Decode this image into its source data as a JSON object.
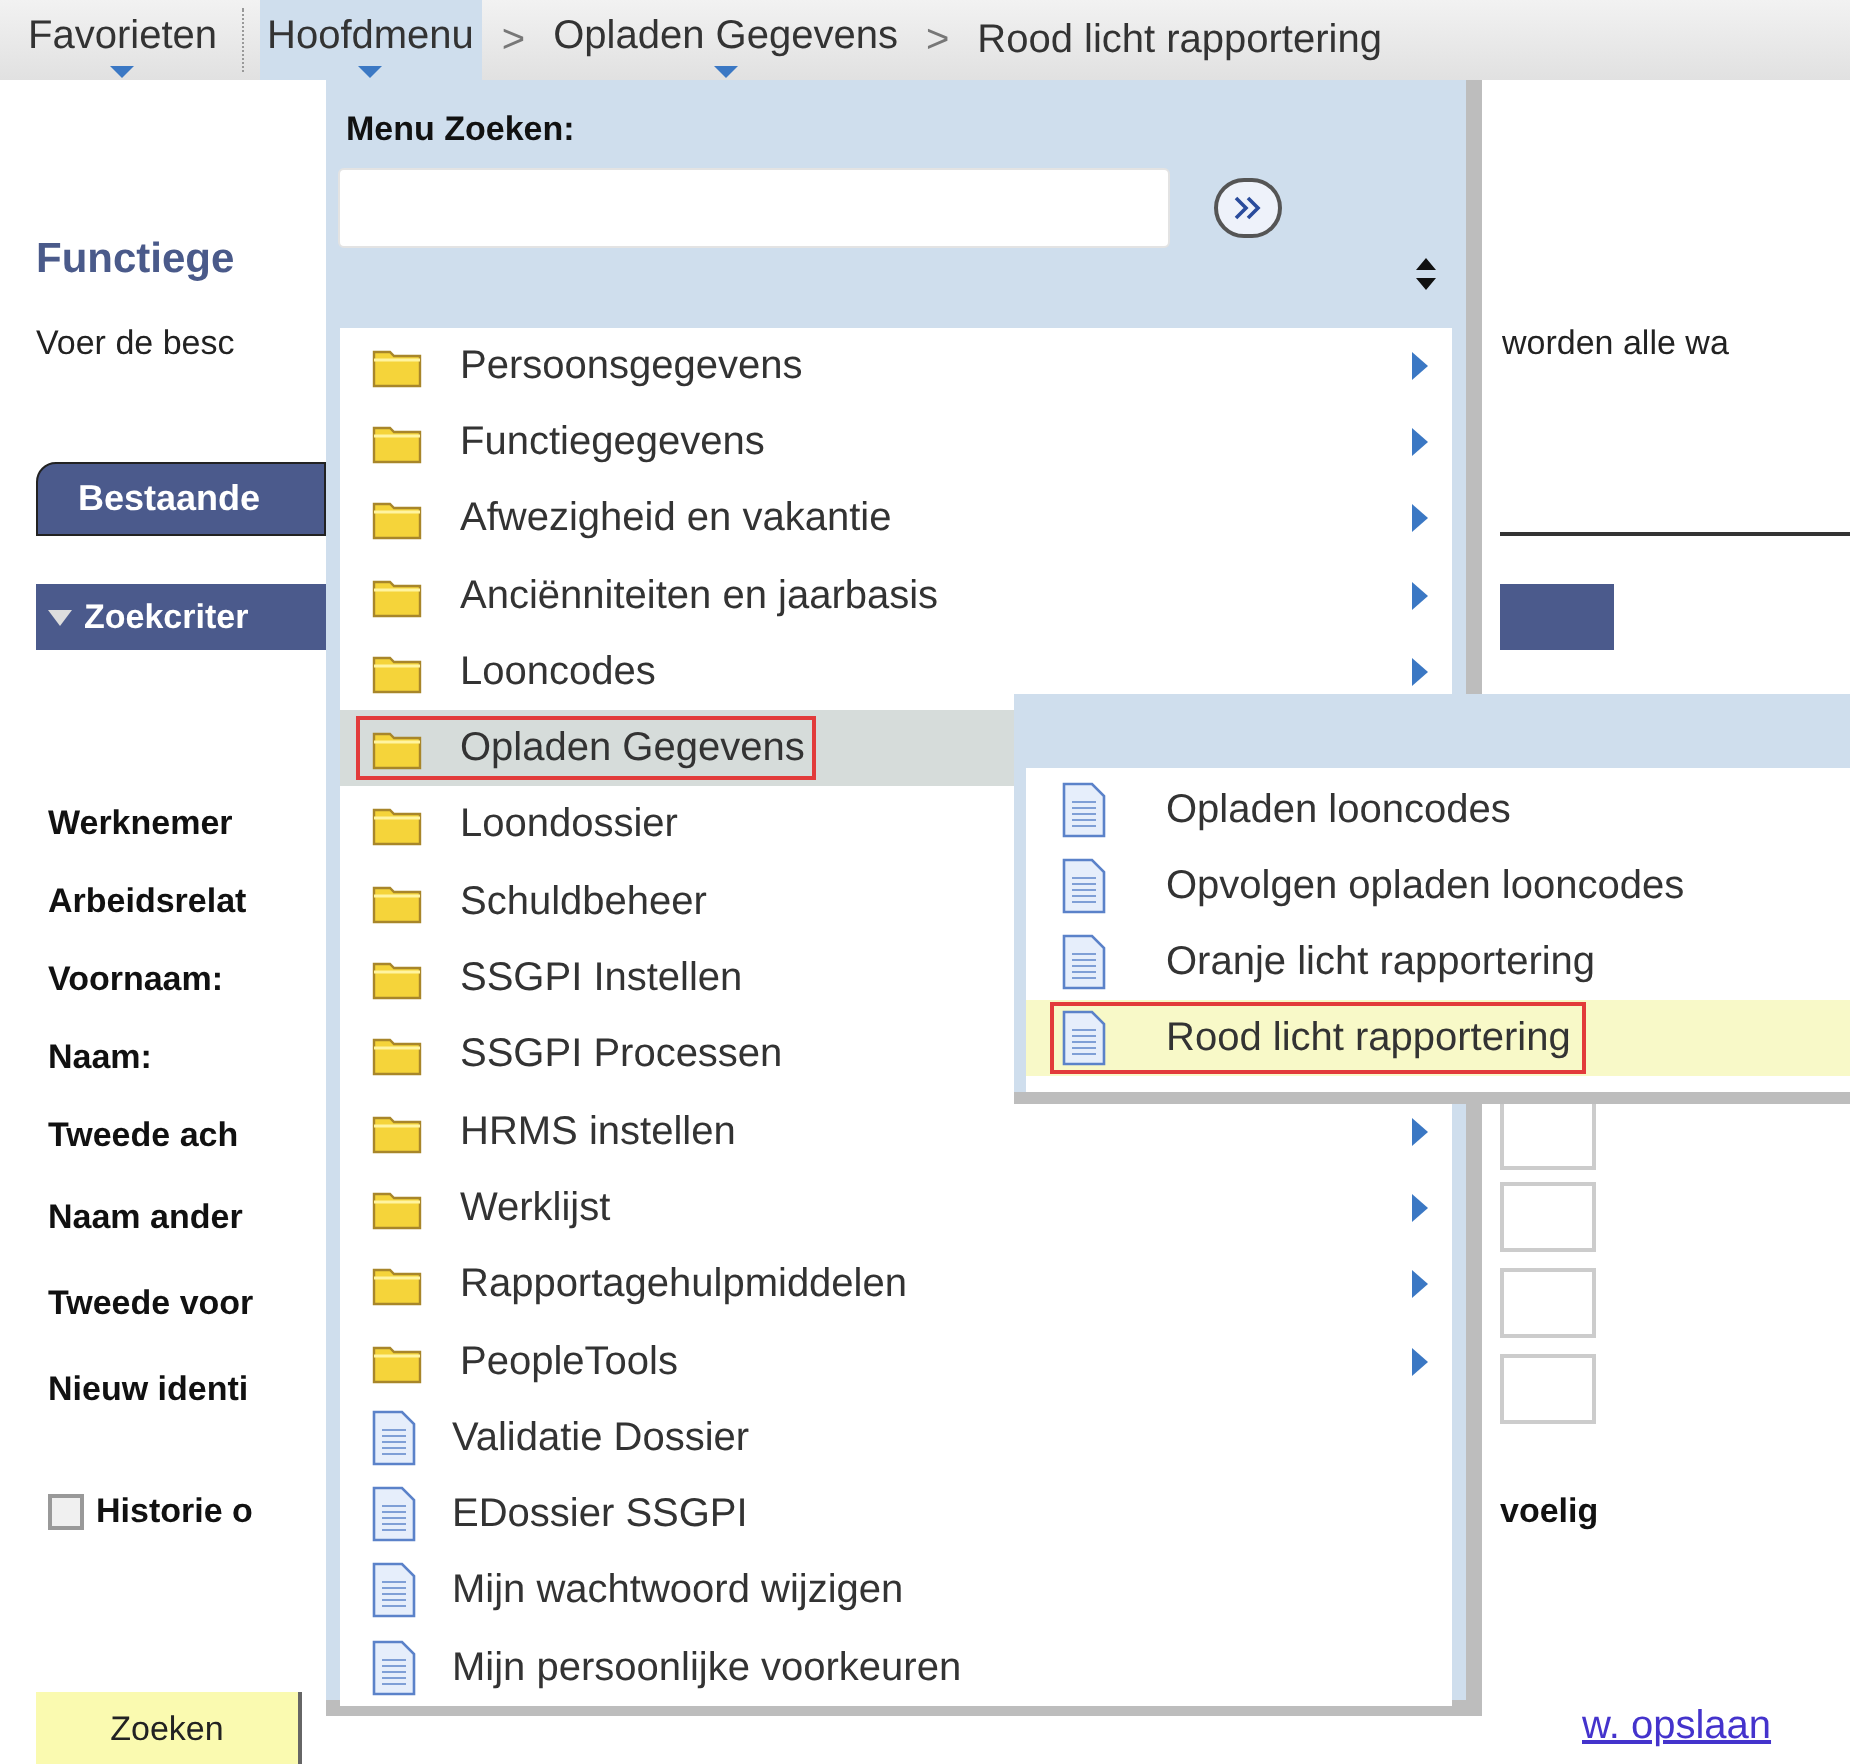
{
  "breadcrumb": [
    {
      "label": "Favorieten",
      "selected": false,
      "dropdown": true
    },
    {
      "label": "Hoofdmenu",
      "selected": true,
      "dropdown": true
    },
    {
      "separator": ">",
      "label": "Opladen Gegevens",
      "selected": false,
      "dropdown": true
    },
    {
      "separator": ">",
      "label": "Rood licht rapportering",
      "selected": false,
      "dropdown": false
    }
  ],
  "page": {
    "title": "Functiege",
    "intro_left": "Voer de besc",
    "intro_right": "worden alle wa",
    "tab": "Bestaande",
    "section": "Zoekcriter",
    "fields": [
      {
        "label": "Werknemer"
      },
      {
        "label": "Arbeidsrelat"
      },
      {
        "label": "Voornaam:"
      },
      {
        "label": "Naam:"
      },
      {
        "label": "Tweede ach",
        "input": true
      },
      {
        "label": "Naam ander",
        "input": true
      },
      {
        "label": "Tweede voor",
        "input": true
      },
      {
        "label": "Nieuw identi",
        "input": true
      }
    ],
    "checkbox": {
      "label_left": "Historie o",
      "label_right": "voelig",
      "checked": false
    },
    "search_button": "Zoeken",
    "link": "w. opslaan"
  },
  "menu": {
    "search_label": "Menu Zoeken:",
    "items": [
      {
        "kind": "folder",
        "label": "Persoonsgegevens",
        "submenu": true,
        "selected": false
      },
      {
        "kind": "folder",
        "label": "Functiegegevens",
        "submenu": true,
        "selected": false
      },
      {
        "kind": "folder",
        "label": "Afwezigheid en vakantie",
        "submenu": true,
        "selected": false
      },
      {
        "kind": "folder",
        "label": "Anciënniteiten en jaarbasis",
        "submenu": true,
        "selected": false
      },
      {
        "kind": "folder",
        "label": "Looncodes",
        "submenu": true,
        "selected": false
      },
      {
        "kind": "folder",
        "label": "Opladen Gegevens",
        "selected": true
      },
      {
        "kind": "folder",
        "label": "Loondossier",
        "selected": false
      },
      {
        "kind": "folder",
        "label": "Schuldbeheer",
        "selected": false
      },
      {
        "kind": "folder",
        "label": "SSGPI Instellen",
        "selected": false
      },
      {
        "kind": "folder",
        "label": "SSGPI Processen",
        "selected": false
      },
      {
        "kind": "folder",
        "label": "HRMS instellen",
        "submenu": true,
        "selected": false
      },
      {
        "kind": "folder",
        "label": "Werklijst",
        "submenu": true,
        "selected": false
      },
      {
        "kind": "folder",
        "label": "Rapportagehulpmiddelen",
        "submenu": true,
        "selected": false
      },
      {
        "kind": "folder",
        "label": "PeopleTools",
        "submenu": true,
        "selected": false
      },
      {
        "kind": "page",
        "label": "Validatie Dossier",
        "submenu": false,
        "selected": false
      },
      {
        "kind": "page",
        "label": "EDossier SSGPI",
        "submenu": false,
        "selected": false
      },
      {
        "kind": "page",
        "label": "Mijn wachtwoord wijzigen",
        "submenu": false,
        "selected": false
      },
      {
        "kind": "page",
        "label": "Mijn persoonlijke voorkeuren",
        "submenu": false,
        "selected": false
      }
    ]
  },
  "submenu": {
    "items": [
      {
        "kind": "page",
        "label": "Opladen looncodes",
        "selected": false
      },
      {
        "kind": "page",
        "label": "Opvolgen opladen looncodes",
        "selected": false
      },
      {
        "kind": "page",
        "label": "Oranje licht rapportering",
        "selected": false
      },
      {
        "kind": "page",
        "label": "Rood licht rapportering",
        "selected": true
      }
    ]
  }
}
